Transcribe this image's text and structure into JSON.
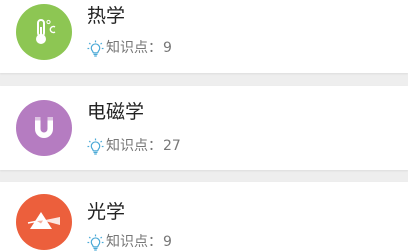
{
  "colors": {
    "thermal": "#8dc653",
    "electromagnetism": "#b57cc1",
    "optics": "#ec5f3c",
    "bulb": "#4aa9d6",
    "background": "#eeeeee"
  },
  "subjects": [
    {
      "icon": "thermometer-icon",
      "title": "热学",
      "knowledge_label": "知识点：",
      "knowledge_count": "9"
    },
    {
      "icon": "magnet-icon",
      "title": "电磁学",
      "knowledge_label": "知识点：",
      "knowledge_count": "27"
    },
    {
      "icon": "prism-icon",
      "title": "光学",
      "knowledge_label": "知识点：",
      "knowledge_count": "9"
    }
  ]
}
